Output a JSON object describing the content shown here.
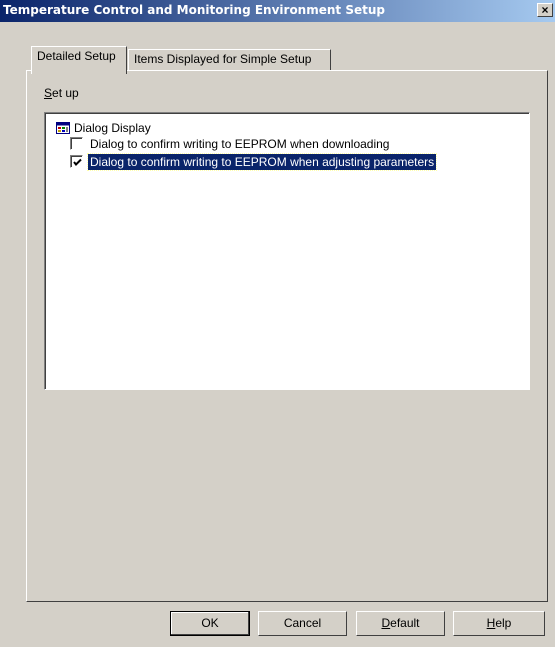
{
  "window": {
    "title": "Temperature Control and Monitoring Environment Setup",
    "close_glyph": "×"
  },
  "tabs": [
    {
      "label": "Detailed Setup",
      "active": true
    },
    {
      "label": "Items Displayed for Simple Setup",
      "active": false
    }
  ],
  "setup": {
    "label_mnemonic": "S",
    "label_rest": "et up"
  },
  "tree": {
    "root": {
      "label": "Dialog Display",
      "icon": "dialog-window-icon"
    },
    "items": [
      {
        "label": "Dialog to confirm writing to EEPROM when downloading",
        "checked": false,
        "selected": false
      },
      {
        "label": "Dialog to confirm writing to EEPROM when adjusting parameters",
        "checked": true,
        "selected": true
      }
    ]
  },
  "buttons": {
    "ok": "OK",
    "cancel": "Cancel",
    "default_mnemonic": "D",
    "default_rest": "efault",
    "help_mnemonic": "H",
    "help_rest": "elp"
  },
  "colors": {
    "title_gradient_start": "#0a246a",
    "title_gradient_end": "#a6caf0",
    "selection": "#0a246a",
    "face": "#d4d0c8"
  }
}
